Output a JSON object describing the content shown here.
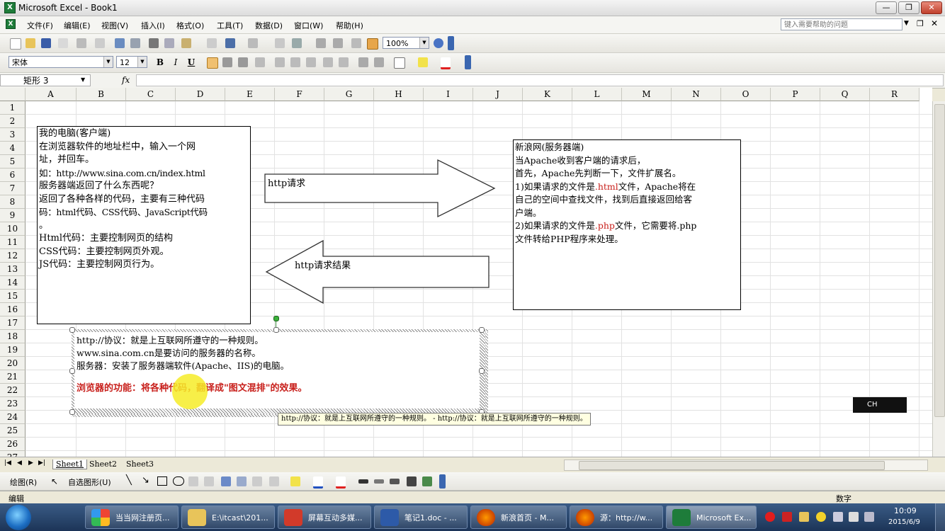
{
  "window": {
    "title": "Microsoft Excel - Book1",
    "min": "—",
    "max": "❐",
    "close": "✕"
  },
  "menu": [
    "文件(F)",
    "编辑(E)",
    "视图(V)",
    "插入(I)",
    "格式(O)",
    "工具(T)",
    "数据(D)",
    "窗口(W)",
    "帮助(H)"
  ],
  "help_placeholder": "键入需要帮助的问题",
  "toolbar": {
    "zoom": "100%"
  },
  "format": {
    "font": "宋体",
    "size": "12",
    "bold": "B",
    "italic": "I",
    "underline": "U"
  },
  "formula": {
    "name_box": "矩形 3",
    "fx": "fx"
  },
  "columns": [
    "A",
    "B",
    "C",
    "D",
    "E",
    "F",
    "G",
    "H",
    "I",
    "J",
    "K",
    "L",
    "M",
    "N",
    "O",
    "P",
    "Q",
    "R"
  ],
  "rows": [
    "1",
    "2",
    "3",
    "4",
    "5",
    "6",
    "7",
    "8",
    "9",
    "10",
    "11",
    "12",
    "13",
    "14",
    "15",
    "16",
    "17",
    "18",
    "19",
    "20",
    "21",
    "22",
    "23",
    "24",
    "25",
    "26",
    "27"
  ],
  "client_box": {
    "lines": [
      "我的电脑(客户端)",
      "",
      "在浏览器软件的地址栏中，输入一个网",
      "址，并回车。",
      "如：http://www.sina.com.cn/index.html",
      "",
      "服务器端返回了什么东西呢？",
      "返回了各种各样的代码，主要有三种代码",
      "码：html代码、CSS代码、JavaScript代码",
      "。",
      "",
      "Html代码：主要控制网页的结构",
      "CSS代码：主要控制网页外观。",
      "JS代码：主要控制网页行为。"
    ]
  },
  "server_box": {
    "l1": "新浪网(服务器端)",
    "l2": "",
    "l3": "当Apache收到客户端的请求后，",
    "l4": "首先，Apache先判断一下，文件扩展名。",
    "l5a": "1)如果请求的文件是",
    "l5b": ".html",
    "l5c": "文件，Apache将在",
    "l6": "自己的空间中查找文件，找到后直接返回给客",
    "l7": "户端。",
    "l8a": "2)如果请求的文件是",
    "l8b": ".php",
    "l8c": "文件，它需要将.php",
    "l9": "文件转给PHP程序来处理。"
  },
  "arrow_right_label": "http请求",
  "arrow_left_label": "http请求结果",
  "note_box": {
    "l1": "http://协议：就是上互联网所遵守的一种规则。",
    "l2": "www.sina.com.cn是要访问的服务器的名称。",
    "l3": "服务器：安装了服务器端软件(Apache、IIS)的电脑。",
    "l4": "浏览器的功能：将各种代码，翻译成\"图文混排\"的效果。"
  },
  "tooltip": "http://协议：就是上互联网所遵守的一种规则。 - http://协议：就是上互联网所遵守的一种规则。",
  "ime": "CH",
  "sheets": [
    "Sheet1",
    "Sheet2",
    "Sheet3"
  ],
  "drawbar": {
    "draw": "绘图(R)",
    "autoshape": "自选图形(U)"
  },
  "status": {
    "left": "编辑",
    "right": "数字"
  },
  "taskbar": {
    "items": [
      "当当网注册页...",
      "E:\\itcast\\201...",
      "屏幕互动多媒...",
      "笔记1.doc - ...",
      "新浪首页 - M...",
      "源：http://w...",
      "Microsoft Ex..."
    ],
    "time": "10:09",
    "date": "2015/6/9"
  },
  "colors": {
    "accent_red": "#c8201c",
    "title_bg": "#dcdcdc",
    "taskbar": "#1c3457"
  }
}
